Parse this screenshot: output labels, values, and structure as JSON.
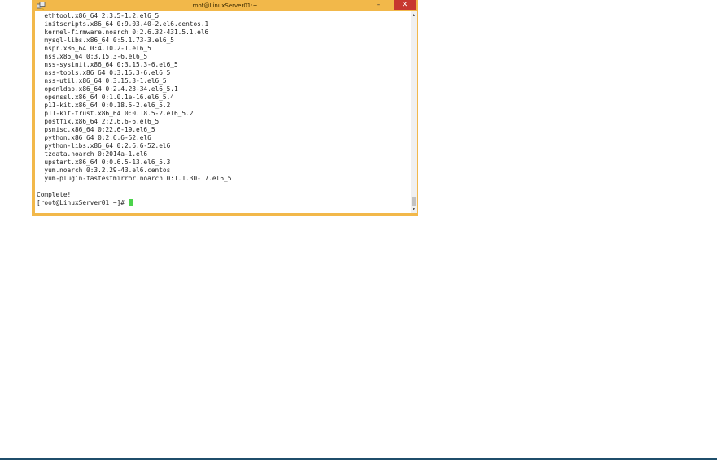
{
  "window": {
    "title": "root@LinuxServer01:~",
    "min_glyph": "–",
    "max_glyph": "▭",
    "close_glyph": "✕",
    "app_icon": "putty-icon",
    "accent": "#f2b84a"
  },
  "terminal": {
    "lines": [
      "  ethtool.x86_64 2:3.5-1.2.el6_5",
      "  initscripts.x86_64 0:9.03.40-2.el6.centos.1",
      "  kernel-firmware.noarch 0:2.6.32-431.5.1.el6",
      "  mysql-libs.x86_64 0:5.1.73-3.el6_5",
      "  nspr.x86_64 0:4.10.2-1.el6_5",
      "  nss.x86_64 0:3.15.3-6.el6_5",
      "  nss-sysinit.x86_64 0:3.15.3-6.el6_5",
      "  nss-tools.x86_64 0:3.15.3-6.el6_5",
      "  nss-util.x86_64 0:3.15.3-1.el6_5",
      "  openldap.x86_64 0:2.4.23-34.el6_5.1",
      "  openssl.x86_64 0:1.0.1e-16.el6_5.4",
      "  p11-kit.x86_64 0:0.18.5-2.el6_5.2",
      "  p11-kit-trust.x86_64 0:0.18.5-2.el6_5.2",
      "  postfix.x86_64 2:2.6.6-6.el6_5",
      "  psmisc.x86_64 0:22.6-19.el6_5",
      "  python.x86_64 0:2.6.6-52.el6",
      "  python-libs.x86_64 0:2.6.6-52.el6",
      "  tzdata.noarch 0:2014a-1.el6",
      "  upstart.x86_64 0:0.6.5-13.el6_5.3",
      "  yum.noarch 0:3.2.29-43.el6.centos",
      "  yum-plugin-fastestmirror.noarch 0:1.1.30-17.el6_5",
      "",
      "Complete!"
    ],
    "prompt": "[root@LinuxServer01 ~]# ",
    "cursor_color": "#4cd34c"
  },
  "scrollbar": {
    "up_glyph": "▴",
    "down_glyph": "▾"
  }
}
